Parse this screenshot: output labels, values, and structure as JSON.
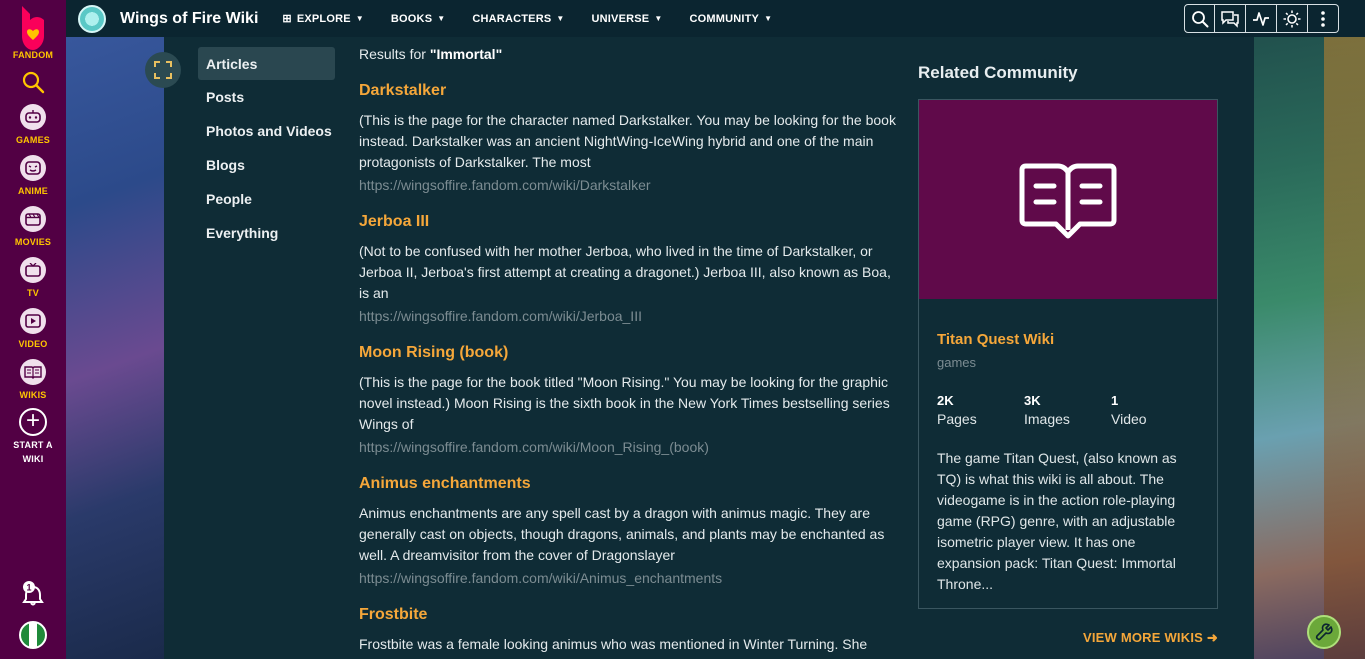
{
  "rail": {
    "brand": "FANDOM",
    "items": [
      {
        "label": "GAMES",
        "icon": "games-icon"
      },
      {
        "label": "ANIME",
        "icon": "anime-icon"
      },
      {
        "label": "MOVIES",
        "icon": "movies-icon"
      },
      {
        "label": "TV",
        "icon": "tv-icon"
      },
      {
        "label": "VIDEO",
        "icon": "video-icon"
      },
      {
        "label": "WIKIS",
        "icon": "wikis-icon"
      }
    ],
    "start_line1": "START A",
    "start_line2": "WIKI",
    "notification_count": "1"
  },
  "topbar": {
    "wiki_name": "Wings of Fire Wiki",
    "nav": [
      "EXPLORE",
      "BOOKS",
      "CHARACTERS",
      "UNIVERSE",
      "COMMUNITY"
    ]
  },
  "filters": [
    "Articles",
    "Posts",
    "Photos and Videos",
    "Blogs",
    "People",
    "Everything"
  ],
  "search": {
    "results_prefix": "Results for ",
    "query": "\"Immortal\"",
    "results": [
      {
        "title": "Darkstalker",
        "snippet": "(This is the page for the character named Darkstalker. You may be looking for the book instead. Darkstalker was an ancient NightWing-IceWing hybrid and one of the main protagonists of Darkstalker. The most",
        "url": "https://wingsoffire.fandom.com/wiki/Darkstalker"
      },
      {
        "title": "Jerboa III",
        "snippet": "(Not to be confused with her mother Jerboa, who lived in the time of Darkstalker, or Jerboa II, Jerboa's first attempt at creating a dragonet.) Jerboa III, also known as Boa, is an",
        "url": "https://wingsoffire.fandom.com/wiki/Jerboa_III"
      },
      {
        "title": "Moon Rising (book)",
        "snippet": "(This is the page for the book titled \"Moon Rising.\" You may be looking for the graphic novel instead.) Moon Rising is the sixth book in the New York Times bestselling series Wings of",
        "url": "https://wingsoffire.fandom.com/wiki/Moon_Rising_(book)"
      },
      {
        "title": "Animus enchantments",
        "snippet": "Animus enchantments are any spell cast by a dragon with animus magic. They are generally cast on objects, though dragons, animals, and plants may be enchanted as well. A dreamvisitor from the cover of Dragonslayer",
        "url": "https://wingsoffire.fandom.com/wiki/Animus_enchantments"
      },
      {
        "title": "Frostbite",
        "snippet": "Frostbite was a female looking animus who was mentioned in Winter Turning. She",
        "url": ""
      }
    ]
  },
  "related": {
    "heading": "Related Community",
    "wiki_name": "Titan Quest Wiki",
    "category": "games",
    "stats": [
      {
        "num": "2K",
        "label": "Pages"
      },
      {
        "num": "3K",
        "label": "Images"
      },
      {
        "num": "1",
        "label": "Video"
      }
    ],
    "description": "The game Titan Quest, (also known as TQ) is what this wiki is all about. The videogame is in the action role-playing game (RPG) genre, with an adjustable isometric player view. It has one expansion pack: Titan Quest: Immortal Throne...",
    "view_more": "VIEW MORE WIKIS"
  },
  "colors": {
    "accent": "#f5a73a",
    "rail": "#520044",
    "brand_yellow": "#ffc500",
    "panel": "#0f2c36"
  }
}
